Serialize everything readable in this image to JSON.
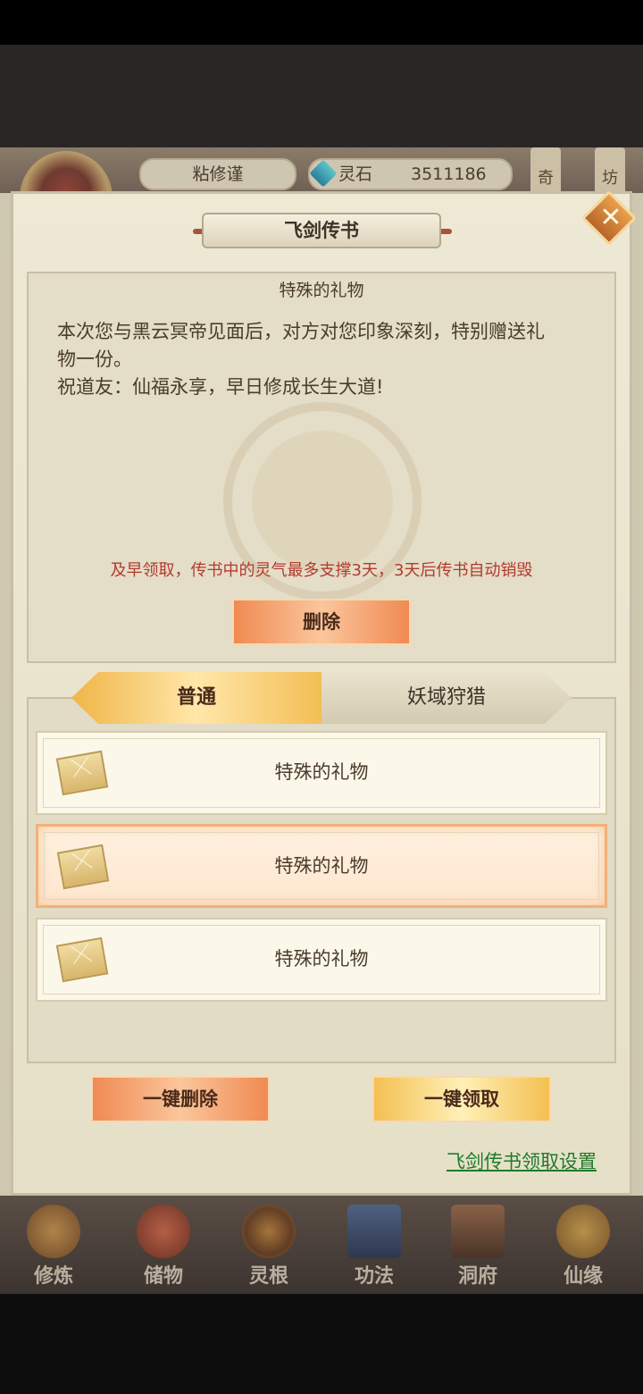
{
  "hud": {
    "player_name": "粘修谨",
    "currency_label": "灵石",
    "currency_value": "3511186",
    "side_1": "奇",
    "side_2": "坊"
  },
  "dialog": {
    "title": "飞剑传书",
    "mail": {
      "title": "特殊的礼物",
      "body_line1": "本次您与黑云冥帝见面后，对方对您印象深刻，特别赠送礼",
      "body_line2": "物一份。",
      "body_line3": "祝道友：仙福永享，早日修成长生大道!",
      "warning": "及早领取，传书中的灵气最多支撑3天，3天后传书自动销毁",
      "delete_label": "删除"
    },
    "tabs": [
      {
        "label": "普通",
        "active": true
      },
      {
        "label": "妖域狩猎",
        "active": false
      }
    ],
    "items": [
      {
        "label": "特殊的礼物",
        "icon": "envelope-icon",
        "selected": false
      },
      {
        "label": "特殊的礼物",
        "icon": "envelope-icon",
        "selected": true
      },
      {
        "label": "特殊的礼物",
        "icon": "envelope-icon",
        "selected": false
      }
    ],
    "delete_all_label": "一键删除",
    "claim_all_label": "一键领取",
    "settings_link": "飞剑传书领取设置"
  },
  "bottom_nav": [
    {
      "label": "修炼",
      "icon": "monk-icon"
    },
    {
      "label": "储物",
      "icon": "bag-icon"
    },
    {
      "label": "灵根",
      "icon": "root-icon"
    },
    {
      "label": "功法",
      "icon": "book-icon"
    },
    {
      "label": "洞府",
      "icon": "cave-icon"
    },
    {
      "label": "仙缘",
      "icon": "gourd-icon"
    }
  ],
  "colors": {
    "accent_orange": "#f08a52",
    "accent_gold": "#f3c052",
    "warning_red": "#b33a2f",
    "link_green": "#1f7a2a"
  }
}
